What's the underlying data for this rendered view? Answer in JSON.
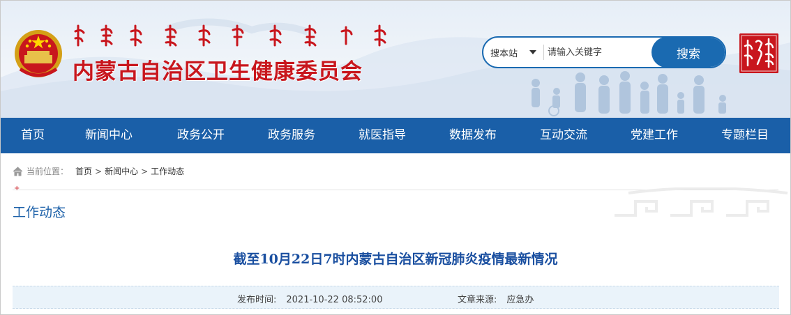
{
  "header": {
    "site_title": "内蒙古自治区卫生健康委员会",
    "search": {
      "scope_label": "搜本站",
      "placeholder": "请输入关键字",
      "button_label": "搜索"
    }
  },
  "nav": {
    "items": [
      {
        "label": "首页"
      },
      {
        "label": "新闻中心"
      },
      {
        "label": "政务公开"
      },
      {
        "label": "政务服务"
      },
      {
        "label": "就医指导"
      },
      {
        "label": "数据发布"
      },
      {
        "label": "互动交流"
      },
      {
        "label": "党建工作"
      },
      {
        "label": "专题栏目"
      }
    ]
  },
  "breadcrumb": {
    "label": "当前位置：",
    "items": [
      "首页",
      "新闻中心",
      "工作动态"
    ],
    "separator": ">"
  },
  "section": {
    "heading": "工作动态"
  },
  "article": {
    "title": "截至10月22日7时内蒙古自治区新冠肺炎疫情最新情况",
    "publish_label": "发布时间:",
    "publish_time": "2021-10-22 08:52:00",
    "source_label": "文章来源:",
    "source_value": "应急办"
  },
  "colors": {
    "brand_red": "#c8161d",
    "nav_blue": "#1a5fa8",
    "title_blue": "#1a4fa0",
    "meta_bg": "#eaf3fa"
  },
  "icons": {
    "emblem": "national-emblem-icon",
    "seal": "mongolian-seal-icon",
    "home": "home-icon",
    "caret": "chevron-down-icon"
  }
}
